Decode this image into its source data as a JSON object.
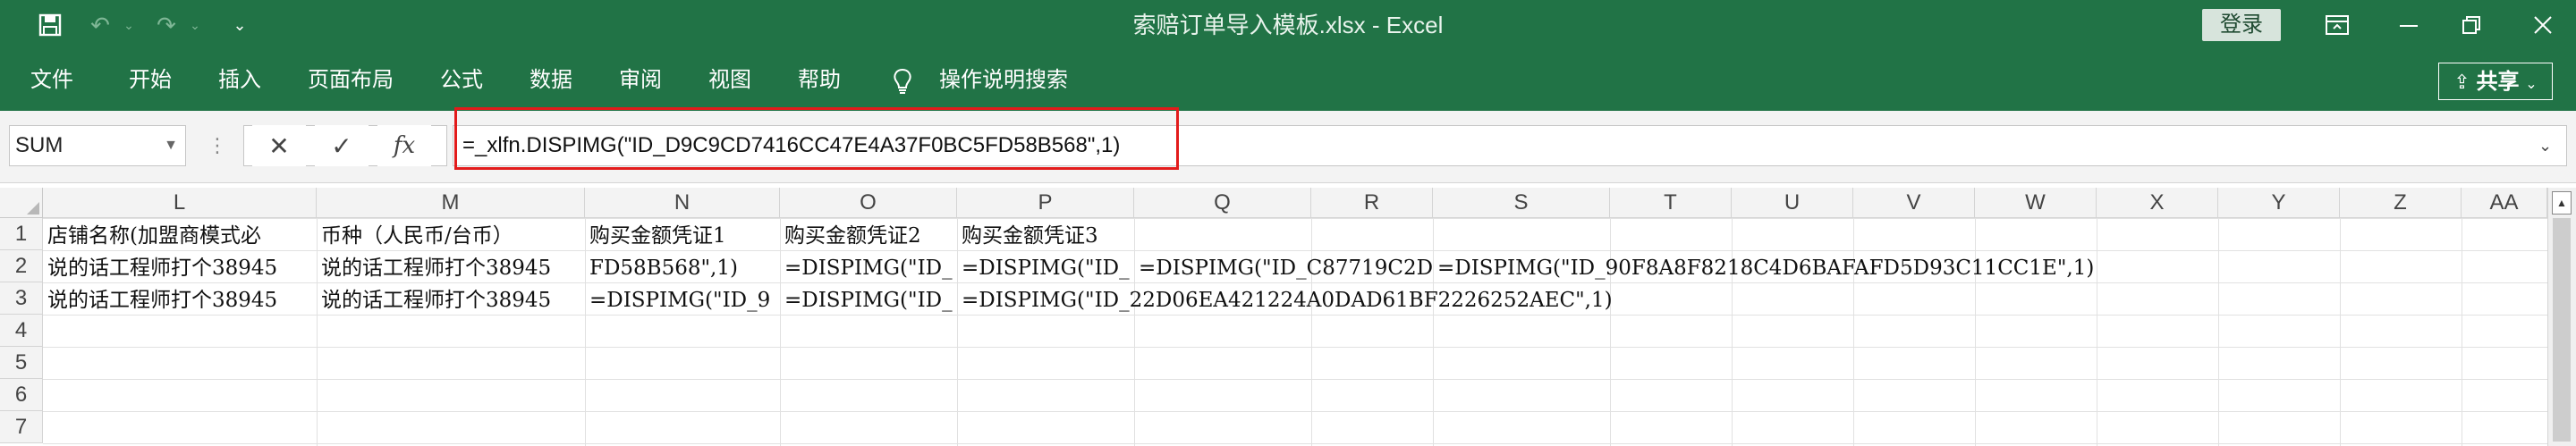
{
  "window": {
    "title": "索赔订单导入模板.xlsx  -  Excel",
    "login_label": "登录"
  },
  "ribbon": {
    "tabs": [
      {
        "label": "文件"
      },
      {
        "label": "开始"
      },
      {
        "label": "插入"
      },
      {
        "label": "页面布局"
      },
      {
        "label": "公式"
      },
      {
        "label": "数据"
      },
      {
        "label": "审阅"
      },
      {
        "label": "视图"
      },
      {
        "label": "帮助"
      },
      {
        "label": "操作说明搜索"
      }
    ],
    "share_label": "共享"
  },
  "formula_bar": {
    "name_box": "SUM",
    "fx": "fx",
    "formula": "=_xlfn.DISPIMG(\"ID_D9C9CD7416CC47E4A37F0BC5FD58B568\",1)"
  },
  "sheet": {
    "columns": [
      "L",
      "M",
      "N",
      "O",
      "P",
      "Q",
      "R",
      "S",
      "T",
      "U",
      "V",
      "W",
      "X",
      "Y",
      "Z",
      "AA"
    ],
    "rows": [
      "1",
      "2",
      "3",
      "4",
      "5",
      "6",
      "7"
    ],
    "cells": {
      "r1": {
        "L": "店铺名称(加盟商模式必",
        "M": "币种（人民币/台币）",
        "N": "购买金额凭证1",
        "O": "购买金额凭证2",
        "P": "购买金额凭证3"
      },
      "r2": {
        "L": "说的话工程师打个38945",
        "M": "说的话工程师打个38945",
        "N": "FD58B568\",1)",
        "O": "=DISPIMG(\"ID_",
        "P": "=DISPIMG(\"ID_",
        "Q": "=DISPIMG(\"ID_C87719C2D",
        "S": "=DISPIMG(\"ID_90F8A8F8218C4D6BAFAFD5D93C11CC1E\",1)"
      },
      "r3": {
        "L": "说的话工程师打个38945",
        "M": "说的话工程师打个38945",
        "N": "=DISPIMG(\"ID_9",
        "O": "=DISPIMG(\"ID_",
        "P": "=DISPIMG(\"ID_22D06EA421224A0DAD61BF2226252AEC\",1)"
      }
    }
  }
}
